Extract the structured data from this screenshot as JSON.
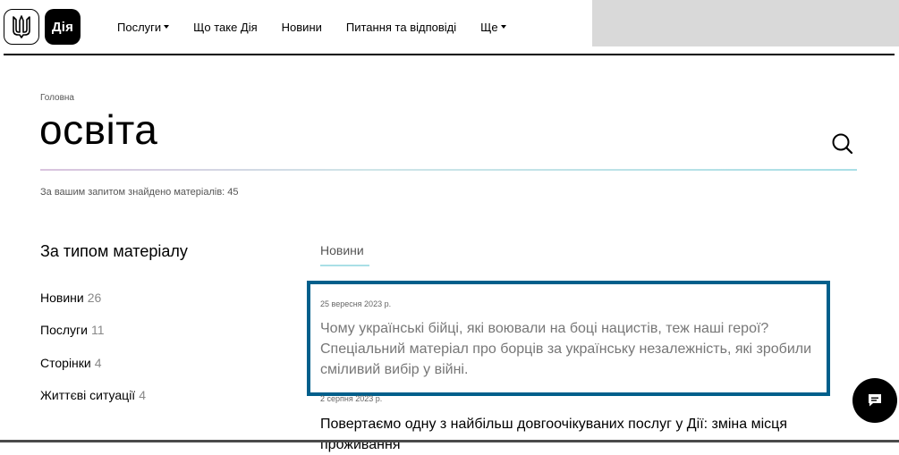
{
  "header": {
    "logo_text": "Дія",
    "nav": [
      {
        "label": "Послуги",
        "has_dropdown": true
      },
      {
        "label": "Що таке Дія",
        "has_dropdown": false
      },
      {
        "label": "Новини",
        "has_dropdown": false
      },
      {
        "label": "Питання та відповіді",
        "has_dropdown": false
      },
      {
        "label": "Ще",
        "has_dropdown": true
      }
    ]
  },
  "breadcrumb": "Головна",
  "search": {
    "query": "освіта",
    "results_text": "За вашим запитом знайдено матеріалів: 45"
  },
  "filters": {
    "heading": "За типом матеріалу",
    "items": [
      {
        "label": "Новини",
        "count": "26"
      },
      {
        "label": "Послуги",
        "count": "11"
      },
      {
        "label": "Сторінки",
        "count": "4"
      },
      {
        "label": "Життєві ситуації",
        "count": "4"
      }
    ]
  },
  "tabs": {
    "active": "Новини"
  },
  "results": [
    {
      "date": "25 вересня 2023 р.",
      "title": "Чому українські бійці, які воювали на боці нацистів, теж наші герої? Спеціальний матеріал про борців за українську незалежність, які зробили сміливий вибір у війні."
    },
    {
      "date": "2 серпня 2023 р.",
      "title": "Повертаємо одну з найбільш довгоочікуваних послуг у Дії: зміна місця проживання"
    }
  ],
  "colors": {
    "highlight_border": "#005f8b",
    "accent_underline": "#a9dfe6",
    "header_block": "#d9d9d9"
  },
  "icons": {
    "trident": "trident-icon",
    "search": "search-icon",
    "chat": "chat-icon"
  }
}
